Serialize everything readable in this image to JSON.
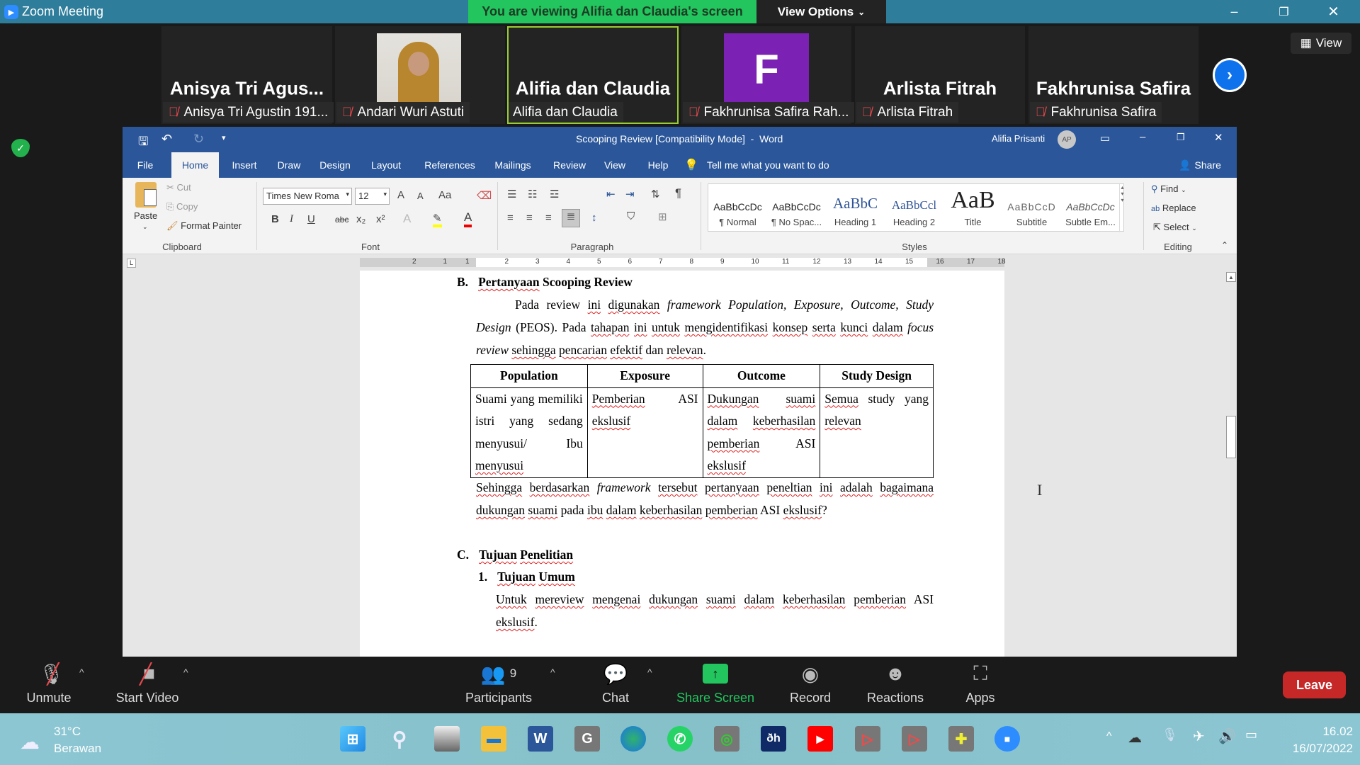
{
  "zoom": {
    "window_title": "Zoom Meeting",
    "banner": "You are viewing Alifia dan Claudia's screen",
    "view_options": "View Options",
    "view_button": "View",
    "participants": [
      {
        "big": "Anisya Tri Agus...",
        "name": "Anisya Tri Agustin 191...",
        "muted": true
      },
      {
        "big": "",
        "name": "Andari Wuri Astuti",
        "muted": true,
        "has_photo": true
      },
      {
        "big": "Alifia dan Claudia",
        "name": "Alifia dan Claudia",
        "muted": false,
        "active": true
      },
      {
        "big": "F",
        "name": "Fakhrunisa Safira Rah...",
        "muted": true,
        "avatar_color": "#7b22b4"
      },
      {
        "big": "Arlista Fitrah",
        "name": "Arlista Fitrah",
        "muted": true
      },
      {
        "big": "Fakhrunisa Safira",
        "name": "Fakhrunisa Safira",
        "muted": true
      }
    ],
    "toolbar": {
      "unmute": "Unmute",
      "start_video": "Start Video",
      "participants": "Participants",
      "participants_count": "9",
      "chat": "Chat",
      "share_screen": "Share Screen",
      "record": "Record",
      "reactions": "Reactions",
      "apps": "Apps",
      "leave": "Leave"
    },
    "colors": {
      "title_bar": "#2e7d9b",
      "banner": "#22c55e",
      "share": "#22c55e",
      "leave": "#c62828",
      "active_border": "#9acd32"
    }
  },
  "word": {
    "title": "Scooping Review [Compatibility Mode]  -  Word",
    "user": "Alifia Prisanti",
    "user_initials": "AP",
    "tabs": [
      "File",
      "Home",
      "Insert",
      "Draw",
      "Design",
      "Layout",
      "References",
      "Mailings",
      "Review",
      "View",
      "Help"
    ],
    "active_tab": "Home",
    "tell_me": "Tell me what you want to do",
    "share": "Share",
    "clipboard": {
      "paste": "Paste",
      "cut": "Cut",
      "copy": "Copy",
      "format_painter": "Format Painter",
      "label": "Clipboard"
    },
    "font": {
      "name": "Times New Roma",
      "size": "12",
      "label": "Font",
      "bold": "B",
      "italic": "I",
      "underline": "U",
      "strike": "abc",
      "grow": "A",
      "shrink": "A",
      "case": "Aa"
    },
    "paragraph": {
      "label": "Paragraph"
    },
    "styles": {
      "label": "Styles",
      "items": [
        {
          "preview": "AaBbCcDc",
          "name": "¶ Normal"
        },
        {
          "preview": "AaBbCcDc",
          "name": "¶ No Spac..."
        },
        {
          "preview": "AaBbC",
          "name": "Heading 1"
        },
        {
          "preview": "AaBbCcl",
          "name": "Heading 2"
        },
        {
          "preview": "AaB",
          "name": "Title"
        },
        {
          "preview": "AaBbCcD",
          "name": "Subtitle"
        },
        {
          "preview": "AaBbCcDc",
          "name": "Subtle Em..."
        }
      ]
    },
    "editing": {
      "label": "Editing",
      "find": "Find",
      "replace": "Replace",
      "select": "Select"
    },
    "ruler": {
      "left": [
        "2",
        "1"
      ],
      "right": [
        "1",
        "2",
        "3",
        "4",
        "5",
        "6",
        "7",
        "8",
        "9",
        "10",
        "11",
        "12",
        "13",
        "14",
        "15",
        "16",
        "17",
        "18"
      ]
    },
    "doc": {
      "heading_b": {
        "num": "B.",
        "segs": [
          [
            "Pertanyaan",
            "s"
          ],
          [
            " Scooping Review",
            ""
          ]
        ]
      },
      "para1": [
        [
          "Pada review ",
          ""
        ],
        [
          "ini",
          "s"
        ],
        [
          " ",
          ""
        ],
        [
          "digunakan",
          "s"
        ],
        [
          " ",
          ""
        ],
        [
          "framework Population, Exposure, Outcome, Study Design",
          "i"
        ],
        [
          " (PEOS). Pada ",
          ""
        ],
        [
          "tahapan",
          "s"
        ],
        [
          " ",
          ""
        ],
        [
          "ini",
          "s"
        ],
        [
          " ",
          ""
        ],
        [
          "untuk",
          "s"
        ],
        [
          " ",
          ""
        ],
        [
          "mengidentifikasi",
          "s"
        ],
        [
          " ",
          ""
        ],
        [
          "konsep",
          "s"
        ],
        [
          " ",
          ""
        ],
        [
          "serta",
          "s"
        ],
        [
          " ",
          ""
        ],
        [
          "kunci",
          "s"
        ],
        [
          " ",
          ""
        ],
        [
          "dalam",
          "s"
        ],
        [
          " ",
          ""
        ],
        [
          "focus review",
          "i"
        ],
        [
          " ",
          ""
        ],
        [
          "sehingga",
          "s"
        ],
        [
          " ",
          ""
        ],
        [
          "pencarian",
          "s"
        ],
        [
          " ",
          ""
        ],
        [
          "efektif",
          "s"
        ],
        [
          " dan ",
          ""
        ],
        [
          "relevan",
          "s"
        ],
        [
          ".",
          ""
        ]
      ],
      "table": {
        "headers": [
          "Population",
          "Exposure",
          "Outcome",
          "Study Design"
        ],
        "cells": [
          [
            [
              "Suami yang memiliki istri yang sedang menyusui/ Ibu ",
              ""
            ],
            [
              "menyusui",
              "s"
            ]
          ],
          [
            [
              "Pemberian",
              "s"
            ],
            [
              " ASI ",
              ""
            ],
            [
              "ekslusif",
              "s"
            ]
          ],
          [
            [
              "Dukungan",
              "s"
            ],
            [
              " ",
              ""
            ],
            [
              "suami",
              "s"
            ],
            [
              " ",
              ""
            ],
            [
              "dalam",
              "s"
            ],
            [
              " ",
              ""
            ],
            [
              "keberhasilan",
              "s"
            ],
            [
              " ",
              ""
            ],
            [
              "pemberian",
              "s"
            ],
            [
              " ASI ",
              ""
            ],
            [
              "ekslusif",
              "s"
            ]
          ],
          [
            [
              "Semua",
              "s"
            ],
            [
              " study yang ",
              ""
            ],
            [
              "relevan",
              "s"
            ]
          ]
        ]
      },
      "para2": [
        [
          "Sehingga",
          "s"
        ],
        [
          " ",
          ""
        ],
        [
          "berdasarkan",
          "s"
        ],
        [
          " ",
          ""
        ],
        [
          "framework",
          "i"
        ],
        [
          " ",
          ""
        ],
        [
          "tersebut",
          "s"
        ],
        [
          " ",
          ""
        ],
        [
          "pertanyaan",
          "s"
        ],
        [
          " ",
          ""
        ],
        [
          "peneltian",
          "s"
        ],
        [
          " ",
          ""
        ],
        [
          "ini",
          "s"
        ],
        [
          " ",
          ""
        ],
        [
          "adalah",
          "s"
        ],
        [
          " ",
          ""
        ],
        [
          "bagaimana",
          "s"
        ],
        [
          " ",
          ""
        ],
        [
          "dukungan",
          "s"
        ],
        [
          " ",
          ""
        ],
        [
          "suami",
          "s"
        ],
        [
          " pada ",
          ""
        ],
        [
          "ibu",
          "s"
        ],
        [
          " ",
          ""
        ],
        [
          "dalam",
          "s"
        ],
        [
          " ",
          ""
        ],
        [
          "keberhasilan",
          "s"
        ],
        [
          " ",
          ""
        ],
        [
          "pemberian",
          "s"
        ],
        [
          " ASI ",
          ""
        ],
        [
          "ekslusif",
          "s"
        ],
        [
          "?",
          ""
        ]
      ],
      "heading_c": {
        "num": "C.",
        "segs": [
          [
            "Tujuan",
            "s"
          ],
          [
            " ",
            ""
          ],
          [
            "Penelitian",
            "s"
          ]
        ]
      },
      "heading_c1": {
        "num": "1.",
        "segs": [
          [
            "Tujuan",
            "s"
          ],
          [
            " ",
            ""
          ],
          [
            "Umum",
            "s"
          ]
        ]
      },
      "para3": [
        [
          "Untuk",
          "s"
        ],
        [
          " ",
          ""
        ],
        [
          "mereview",
          "s"
        ],
        [
          " ",
          ""
        ],
        [
          "mengenai",
          "s"
        ],
        [
          " ",
          ""
        ],
        [
          "dukungan",
          "s"
        ],
        [
          " ",
          ""
        ],
        [
          "suami",
          "s"
        ],
        [
          " ",
          ""
        ],
        [
          "dalam",
          "s"
        ],
        [
          " ",
          ""
        ],
        [
          "keberhasilan",
          "s"
        ],
        [
          " ",
          ""
        ],
        [
          "pemberian",
          "s"
        ],
        [
          " ASI ",
          ""
        ],
        [
          "ekslusif",
          "s"
        ],
        [
          ".",
          ""
        ]
      ]
    },
    "colors": {
      "ribbon_blue": "#2b579a",
      "spell_underline": "#e02020"
    }
  },
  "taskbar": {
    "temp": "31°C",
    "weather": "Berawan",
    "time": "16.02",
    "date": "16/07/2022",
    "apps": [
      "start",
      "search",
      "task-view",
      "file-explorer",
      "word",
      "google",
      "edge",
      "whatsapp",
      "app-green",
      "app-dh",
      "youtube",
      "app-red-1",
      "app-red-2",
      "app-puzzle",
      "zoom"
    ]
  }
}
